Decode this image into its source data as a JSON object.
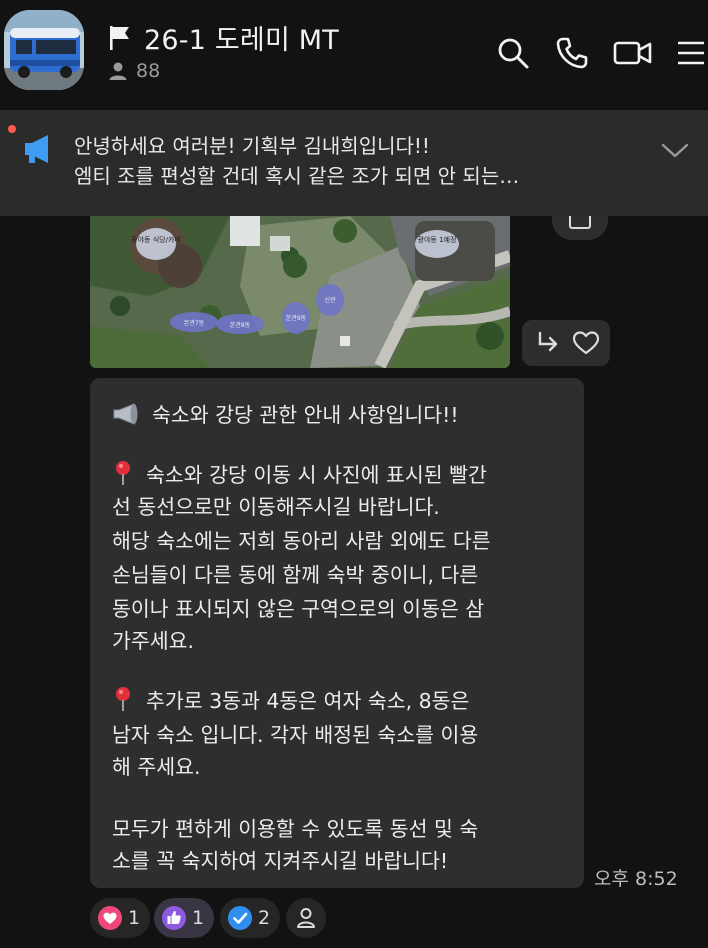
{
  "header": {
    "title": "26-1 도레미 MT",
    "member_count": "88",
    "icons": [
      "flag-icon",
      "person-icon",
      "search-icon",
      "phone-icon",
      "video-icon",
      "menu-icon"
    ]
  },
  "notice": {
    "line1": "안녕하세요 여러분! 기획부 김내희입니다!!",
    "line2": "엠티 조를 편성할 건데 혹시 같은 조가 되면 안 되는…"
  },
  "photo": {
    "labels": [
      "광야동 식당/카페",
      "광야동 1예정",
      "본관7동",
      "본관8동",
      "본관9동",
      "신관"
    ]
  },
  "message": {
    "lines": [
      "숙소와 강당 관한 안내 사항입니다!!",
      "",
      "숙소와 강당 이동 시 사진에 표시된 빨간",
      "선 동선으로만 이동해주시길 바랍니다.",
      "해당 숙소에는 저희 동아리 사람 외에도 다른",
      "손님들이 다른 동에 함께 숙박 중이니, 다른",
      "동이나 표시되지 않은 구역으로의 이동은 삼",
      "가주세요.",
      "",
      "추가로 3동과 4동은 여자 숙소, 8동은",
      "남자 숙소 입니다. 각자 배정된 숙소를 이용",
      "해 주세요.",
      "",
      "모두가 편하게 이용할 수 있도록 동선 및 숙",
      "소를 꼭 숙지하여 지켜주시길 바랍니다!"
    ],
    "time": "오후 8:52"
  },
  "reactions": [
    {
      "icon": "heart-icon",
      "count": "1",
      "color": "#f0477a"
    },
    {
      "icon": "thumbs-up-icon",
      "count": "1",
      "color": "#8e5ae0"
    },
    {
      "icon": "check-icon",
      "count": "2",
      "color": "#2f8ff0"
    }
  ],
  "colors": {
    "background": "#121212",
    "bubble": "#2e2e2e",
    "notice_bar": "#2b2b2b",
    "notice_accent": "#3f9cf2",
    "notice_dot": "#ff5a4e"
  }
}
